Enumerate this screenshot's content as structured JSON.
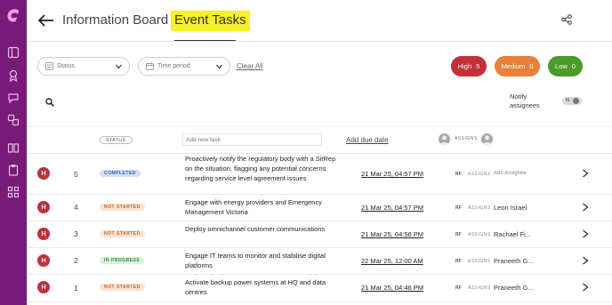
{
  "header": {
    "title": "Information Board",
    "active_tab": "Event Tasks"
  },
  "filters": {
    "status_placeholder": "Status",
    "time_period_placeholder": "Time period",
    "clear_all": "Clear All"
  },
  "priority_pills": [
    {
      "label": "High",
      "count": "5",
      "color": "#c2303a"
    },
    {
      "label": "Medium",
      "count": "0",
      "color": "#e8803a"
    },
    {
      "label": "Low",
      "count": "0",
      "color": "#4c9a2a"
    }
  ],
  "notify": {
    "label": "Notify assignees",
    "toggle_state": "N"
  },
  "table_header": {
    "status": "STATUS",
    "new_task_placeholder": "Add new task",
    "add_due_date": "Add due date",
    "assigns": "ASSIGNS"
  },
  "tasks": [
    {
      "priority": "H",
      "number": "5",
      "status": "COMPLETED",
      "title": "Proactively notify the regulatory body with a SitRep on the situation, flagging any potential concerns regarding service level agreement issues",
      "due": "21 Mar 25, 04:57 PM",
      "initials": "RF",
      "assigns": "ASSIGNS",
      "assignee": "Add Assignee"
    },
    {
      "priority": "H",
      "number": "4",
      "status": "NOT STARTED",
      "title": "Engage with energy providers and Emergency Management Victoria",
      "due": "21 Mar 25, 04:57 PM",
      "initials": "RF",
      "assigns": "ASSIGNS",
      "assignee": "Leon Israel"
    },
    {
      "priority": "H",
      "number": "3",
      "status": "NOT STARTED",
      "title": "Deploy omnichannel customer communications",
      "due": "21 Mar 25, 04:56 PM",
      "initials": "RF",
      "assigns": "ASSIGNS",
      "assignee": "Rachael Fi..."
    },
    {
      "priority": "H",
      "number": "2",
      "status": "IN PROGRESS",
      "title": "Engage IT teams to monitor and stabilise digital platforms",
      "due": "22 Mar 25, 12:00 AM",
      "initials": "RF",
      "assigns": "ASSIGNS",
      "assignee": "Praneeth G..."
    },
    {
      "priority": "H",
      "number": "1",
      "status": "NOT STARTED",
      "title": "Activate backup power systems at HQ and data centres",
      "due": "21 Mar 25, 04:46 PM",
      "initials": "RF",
      "assigns": "ASSIGNS",
      "assignee": "Praneeth G..."
    }
  ],
  "icons": {
    "sidebar": [
      "app-logo-icon",
      "grid-icon",
      "award-icon",
      "chat-icon",
      "link-icon",
      "book-icon",
      "clipboard-icon",
      "apps-icon"
    ],
    "header": [
      "back-arrow-icon",
      "share-icon"
    ]
  },
  "colors": {
    "sidebar": "#7a1a78",
    "tab_highlight": "#f6f02a",
    "priority_high": "#c2303a"
  }
}
